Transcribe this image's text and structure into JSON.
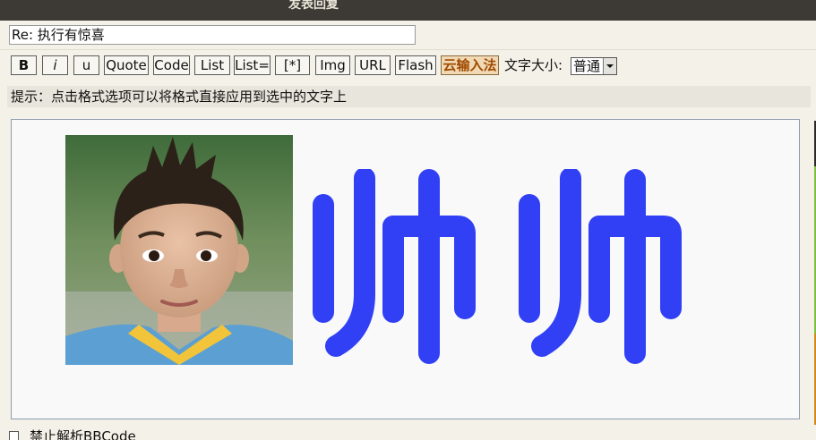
{
  "window": {
    "title": "发表回复"
  },
  "subject": {
    "value": "Re: 执行有惊喜"
  },
  "toolbar": {
    "buttons": [
      "B",
      "i",
      "u",
      "Quote",
      "Code",
      "List",
      "List=",
      "[*]",
      "Img",
      "URL",
      "Flash",
      "云输入法"
    ],
    "font_size_label": "文字大小:",
    "font_size_value": "普通"
  },
  "hint": "提示：点击格式选项可以将格式直接应用到选中的文字上",
  "editor": {
    "content_text": "帅帅",
    "content_text_color": "#3140f5"
  },
  "options": {
    "disable_bbcode_label": "禁止解析BBCode"
  }
}
